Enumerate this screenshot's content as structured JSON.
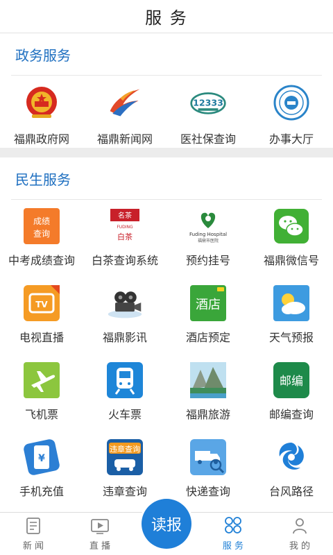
{
  "header": {
    "title": "服 务"
  },
  "gov_section": {
    "title": "政务服务",
    "items": [
      {
        "label": "福鼎政府网",
        "icon": "national-emblem-icon"
      },
      {
        "label": "福鼎新闻网",
        "icon": "news-flame-icon"
      },
      {
        "label": "医社保查询",
        "icon": "12333-icon",
        "icon_text": "12333"
      },
      {
        "label": "办事大厅",
        "icon": "service-hall-seal-icon"
      }
    ]
  },
  "life_section": {
    "title": "民生服务",
    "items": [
      {
        "label": "中考成绩查询",
        "icon": "exam-score-icon",
        "icon_text": "成绩查询"
      },
      {
        "label": "白茶查询系统",
        "icon": "white-tea-icon"
      },
      {
        "label": "预约挂号",
        "icon": "hospital-icon",
        "icon_text": "Fuding Hospital 福鼎市医院"
      },
      {
        "label": "福鼎微信号",
        "icon": "wechat-icon"
      },
      {
        "label": "电视直播",
        "icon": "tv-live-icon"
      },
      {
        "label": "福鼎影讯",
        "icon": "film-icon"
      },
      {
        "label": "酒店预定",
        "icon": "hotel-icon",
        "icon_text": "酒店"
      },
      {
        "label": "天气预报",
        "icon": "weather-icon"
      },
      {
        "label": "飞机票",
        "icon": "airplane-icon"
      },
      {
        "label": "火车票",
        "icon": "train-icon"
      },
      {
        "label": "福鼎旅游",
        "icon": "scenery-icon"
      },
      {
        "label": "邮编查询",
        "icon": "postcode-icon",
        "icon_text": "邮编"
      },
      {
        "label": "手机充值",
        "icon": "phone-recharge-icon"
      },
      {
        "label": "违章查询",
        "icon": "traffic-violation-icon",
        "icon_text": "违章查询"
      },
      {
        "label": "快递查询",
        "icon": "express-truck-icon"
      },
      {
        "label": "台风路径",
        "icon": "typhoon-icon"
      }
    ]
  },
  "bottom_nav": {
    "items": [
      {
        "label": "新 闻",
        "icon": "news-icon"
      },
      {
        "label": "直 播",
        "icon": "live-play-icon"
      },
      {
        "label": "读报",
        "icon": "read-paper-button"
      },
      {
        "label": "服 务",
        "icon": "service-grid-icon",
        "active": true
      },
      {
        "label": "我 的",
        "icon": "profile-icon"
      }
    ]
  },
  "colors": {
    "accent": "#1e6fc0",
    "nav_active": "#1e7fd6",
    "read_button": "#1f7fd8"
  }
}
